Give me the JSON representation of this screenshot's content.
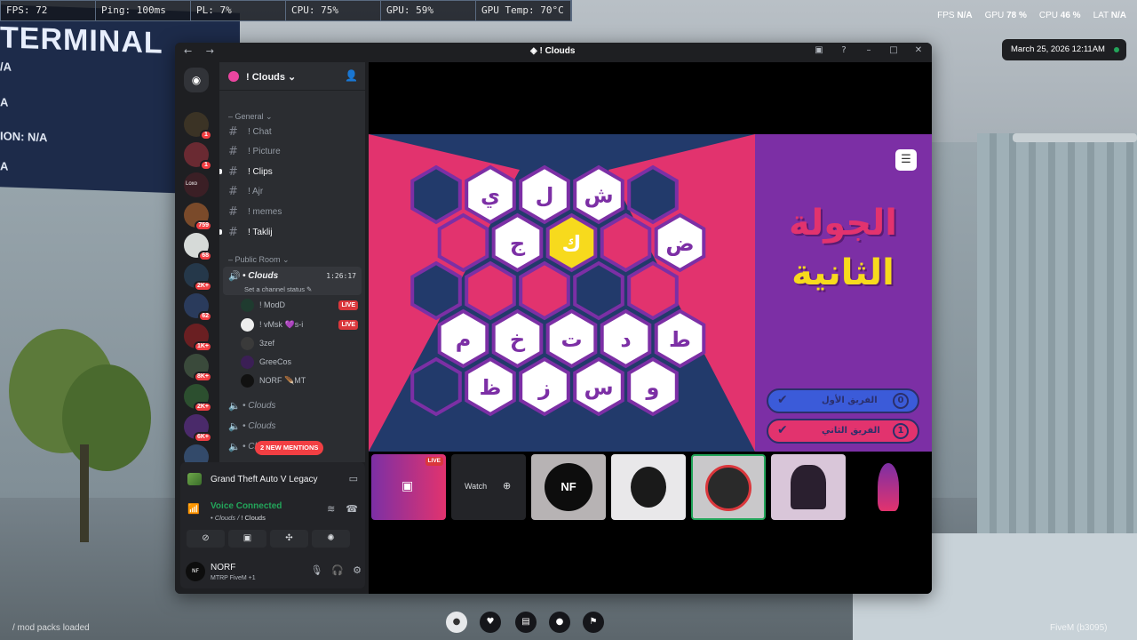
{
  "overlay": {
    "stats": [
      "FPS: 72",
      "Ping: 100ms",
      "PL: 7%",
      "CPU: 75%",
      "GPU: 59%",
      "GPU Temp: 70°C"
    ],
    "perf": {
      "fps_label": "FPS",
      "fps_value": "N/A",
      "gpu_label": "GPU",
      "gpu_value": "78 %",
      "cpu_label": "CPU",
      "cpu_value": "46 %",
      "lat_label": "LAT",
      "lat_value": "N/A"
    },
    "clock": "March 25, 2026 12:11AM"
  },
  "background_panel": {
    "title": "TERMINAL",
    "lines": [
      "/A",
      "A",
      "ION: N/A",
      "A"
    ]
  },
  "window": {
    "title": "! Clouds",
    "nav": "← →"
  },
  "servers": [
    {
      "badge": "1",
      "color": "#3b3325"
    },
    {
      "badge": "1",
      "color": "#6a2a32"
    },
    {
      "badge": "",
      "label": "Loxo",
      "color": "#3b1f25"
    },
    {
      "badge": "759",
      "color": "#7a4a2a"
    },
    {
      "badge": "68",
      "color": "#d6dad8"
    },
    {
      "badge": "2K+",
      "color": "#25384a"
    },
    {
      "badge": "62",
      "color": "#2a3b5c"
    },
    {
      "badge": "1K+",
      "color": "#6a1f22"
    },
    {
      "badge": "8K+",
      "color": "#3a4a3b"
    },
    {
      "badge": "2K+",
      "color": "#2c4f2f"
    },
    {
      "badge": "6K+",
      "color": "#4a2a6a"
    },
    {
      "badge": "",
      "color": "#334a6a"
    }
  ],
  "guild": {
    "name": "! Clouds",
    "categories": {
      "general": "General",
      "public": "Public Room"
    },
    "channels": [
      "! Chat",
      "! Picture",
      "! Clips",
      "! Ajr",
      "! memes",
      "! Taklij"
    ],
    "voice": {
      "name": "• Clouds",
      "time": "1:26:17",
      "status": "Set a channel status",
      "members": [
        {
          "name": "! ModD",
          "live": "LIVE",
          "color": "#1f3b2f"
        },
        {
          "name": "! vMsk 💜s-i",
          "live": "LIVE",
          "color": "#eeeeee"
        },
        {
          "name": "3zef",
          "live": "",
          "color": "#3a3a3a"
        },
        {
          "name": "GreeCos",
          "live": "",
          "color": "#3b1f55"
        },
        {
          "name": "NORF 🪶MT",
          "live": "",
          "color": "#111111"
        }
      ]
    },
    "other_voice": [
      "• Clouds",
      "• Clouds",
      "• Clo"
    ],
    "mentions": "2 NEW MENTIONS"
  },
  "panel": {
    "game": "Grand Theft Auto V Legacy",
    "voice_title": "Voice Connected",
    "voice_channel": "• Clouds",
    "voice_server": "! Clouds",
    "user_name": "NORF",
    "user_status": "MTRP FiveM +1",
    "avatar_text": "NF"
  },
  "game": {
    "round_line1": "الجولة",
    "round_line2": "الثانية",
    "team1": "الفريق الأول",
    "team1_score": "0",
    "team2": "الفريق الثاني",
    "team2_score": "1",
    "hex_colors": {
      "pink": "#e2336e",
      "navy": "#223a6b",
      "yellow": "#f7da1d",
      "white": "#ffffff",
      "border": "#7c2fa5"
    },
    "tiles": [
      {
        "c": 0,
        "r": 0,
        "type": "navy",
        "letter": ""
      },
      {
        "c": 1,
        "r": 0,
        "type": "white",
        "letter": "ي"
      },
      {
        "c": 2,
        "r": 0,
        "type": "white",
        "letter": "ل"
      },
      {
        "c": 3,
        "r": 0,
        "type": "white",
        "letter": "ش"
      },
      {
        "c": 4,
        "r": 0,
        "type": "navy",
        "letter": ""
      },
      {
        "c": 0,
        "r": 1,
        "type": "pink",
        "letter": ""
      },
      {
        "c": 1,
        "r": 1,
        "type": "white",
        "letter": "ج"
      },
      {
        "c": 2,
        "r": 1,
        "type": "yellow",
        "letter": "ك"
      },
      {
        "c": 3,
        "r": 1,
        "type": "pink",
        "letter": ""
      },
      {
        "c": 4,
        "r": 1,
        "type": "white",
        "letter": "ض"
      },
      {
        "c": 0,
        "r": 2,
        "type": "navy",
        "letter": ""
      },
      {
        "c": 1,
        "r": 2,
        "type": "pink",
        "letter": ""
      },
      {
        "c": 2,
        "r": 2,
        "type": "pink",
        "letter": ""
      },
      {
        "c": 3,
        "r": 2,
        "type": "navy",
        "letter": ""
      },
      {
        "c": 4,
        "r": 2,
        "type": "pink",
        "letter": ""
      },
      {
        "c": 0,
        "r": 3,
        "type": "white",
        "letter": "م"
      },
      {
        "c": 1,
        "r": 3,
        "type": "white",
        "letter": "خ"
      },
      {
        "c": 2,
        "r": 3,
        "type": "white",
        "letter": "ت"
      },
      {
        "c": 3,
        "r": 3,
        "type": "white",
        "letter": "د"
      },
      {
        "c": 4,
        "r": 3,
        "type": "white",
        "letter": "ط"
      },
      {
        "c": 0,
        "r": 4,
        "type": "navy",
        "letter": ""
      },
      {
        "c": 1,
        "r": 4,
        "type": "white",
        "letter": "ظ"
      },
      {
        "c": 2,
        "r": 4,
        "type": "white",
        "letter": "ز"
      },
      {
        "c": 3,
        "r": 4,
        "type": "white",
        "letter": "س"
      },
      {
        "c": 4,
        "r": 4,
        "type": "white",
        "letter": "و"
      }
    ]
  },
  "streams": {
    "live": "LIVE",
    "watch": "Watch",
    "nf_label": "NF"
  },
  "hud": {
    "mods": "/ mod packs loaded",
    "fivem": "FiveM (b3095)"
  }
}
